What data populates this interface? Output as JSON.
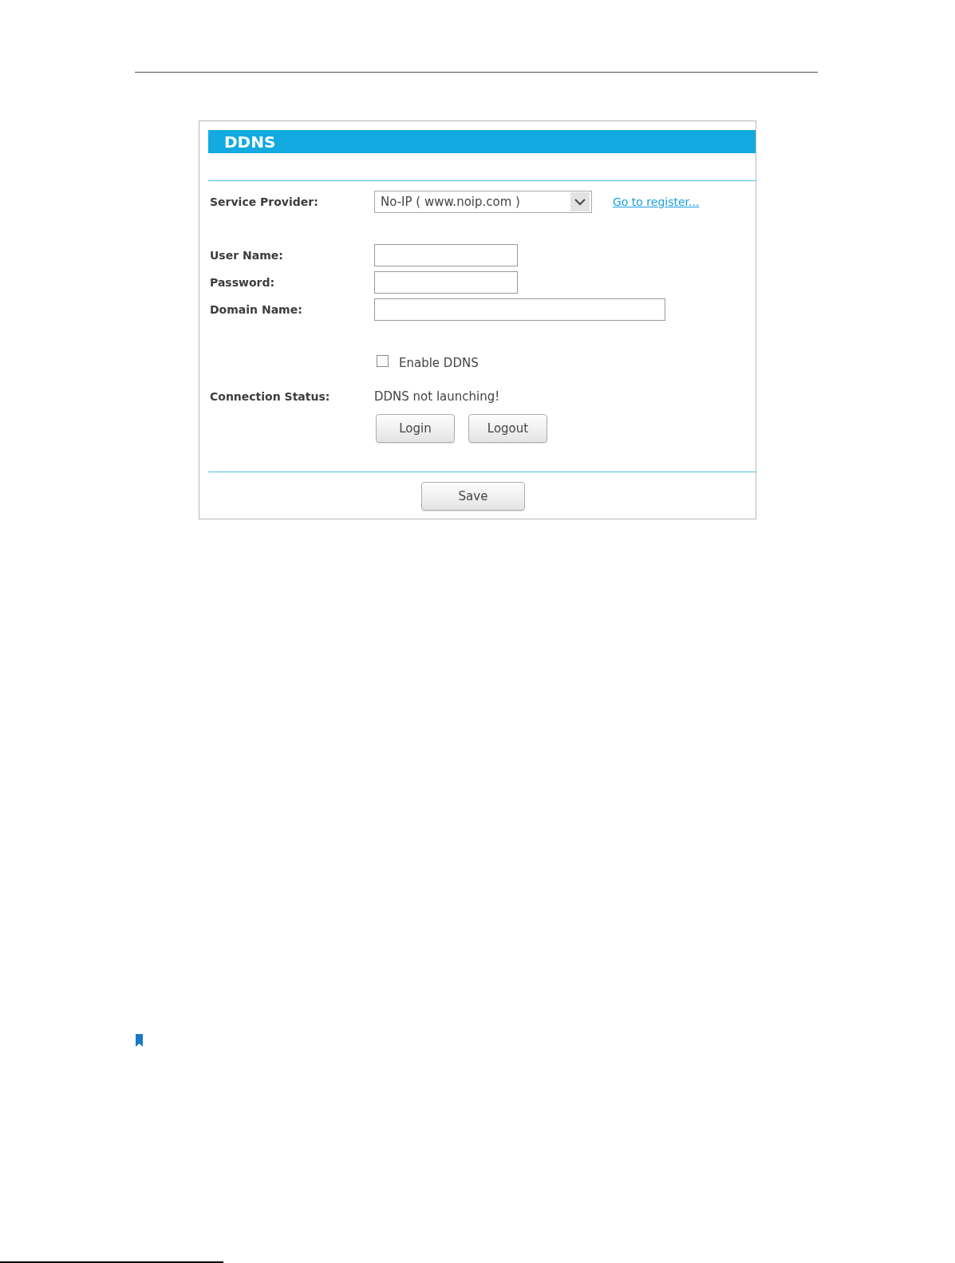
{
  "panel": {
    "title": "DDNS",
    "provider": {
      "label": "Service Provider:",
      "value": "No-IP ( www.noip.com )",
      "link": "Go to register..."
    },
    "fields": [
      {
        "kind": "short",
        "label": "User Name:"
      },
      {
        "kind": "short",
        "label": "Password:"
      },
      {
        "kind": "long",
        "label": "Domain Name:"
      }
    ],
    "enable": {
      "label": "Enable DDNS",
      "checked": false
    },
    "status": {
      "label": "Connection Status:",
      "value": "DDNS not launching!"
    },
    "actions": [
      "Login",
      "Logout"
    ],
    "save": "Save"
  }
}
